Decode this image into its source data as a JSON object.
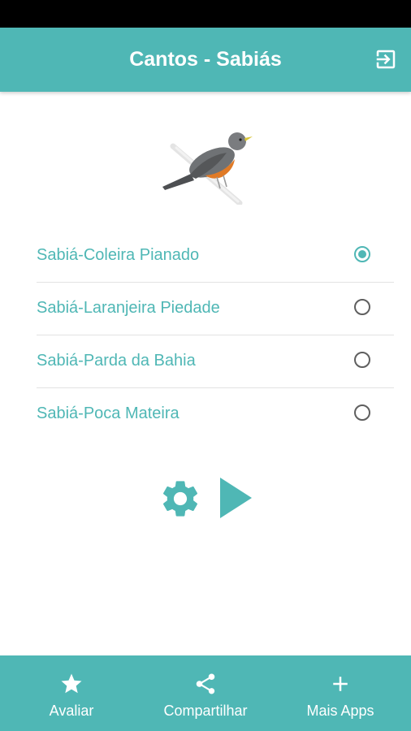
{
  "app_bar": {
    "title": "Cantos - Sabiás",
    "exit_icon": "exit-to-app-icon"
  },
  "colors": {
    "accent": "#4fb7b5",
    "status_bar": "#000000",
    "radio_unchecked": "#5f5f5f",
    "divider": "#e2e2e2"
  },
  "bird_image": "sabia-bird-illustration",
  "songs": [
    {
      "label": "Sabiá-Coleira Pianado",
      "selected": true
    },
    {
      "label": "Sabiá-Laranjeira Piedade",
      "selected": false
    },
    {
      "label": "Sabiá-Parda da Bahia",
      "selected": false
    },
    {
      "label": "Sabiá-Poca Mateira",
      "selected": false
    }
  ],
  "controls": {
    "settings_icon": "gear-icon",
    "play_icon": "play-icon"
  },
  "bottom_nav": {
    "rate": {
      "label": "Avaliar",
      "icon": "star-icon"
    },
    "share": {
      "label": "Compartilhar",
      "icon": "share-icon"
    },
    "more_apps": {
      "label": "Mais Apps",
      "icon": "plus-icon"
    }
  }
}
